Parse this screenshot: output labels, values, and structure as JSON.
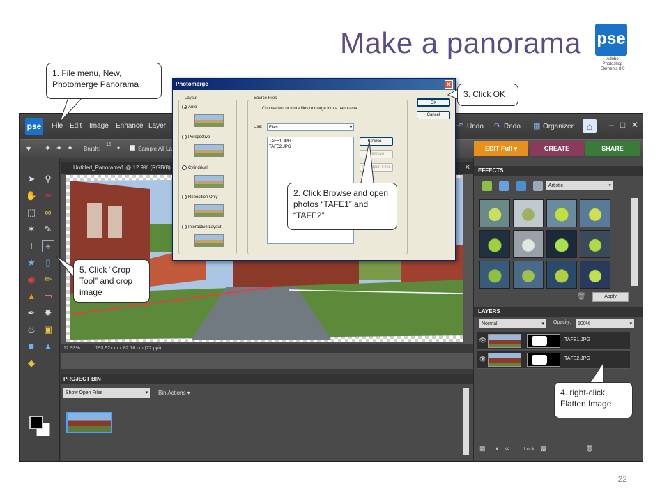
{
  "slide": {
    "title": "Make a panorama",
    "page_number": "22"
  },
  "logo": {
    "mark": "pse",
    "caption": [
      "Adobe",
      "Photoshop",
      "Elements 8.0"
    ]
  },
  "app": {
    "logo": "pse",
    "menu": [
      "File",
      "Edit",
      "Image",
      "Enhance",
      "Layer"
    ],
    "top_right": {
      "undo": "Undo",
      "redo": "Redo",
      "organizer": "Organizer"
    },
    "options": {
      "brush_label": "Brush:",
      "brush_size": "15",
      "sample_all": "Sample All Lay"
    },
    "mode_tabs": [
      "EDIT Full",
      "CREATE",
      "SHARE"
    ],
    "document": {
      "title": "Untitled_Panorama1 @ 12.9% (RGB/8) *",
      "zoom": "12.93%",
      "dimensions": "193.92 cm x 82.76 cm (72 ppi)"
    },
    "project_bin": {
      "header": "PROJECT BIN",
      "show": "Show Open Files",
      "actions": "Bin Actions"
    },
    "effects": {
      "header": "EFFECTS",
      "filter": "Artistic",
      "apply": "Apply"
    },
    "layers": {
      "header": "LAYERS",
      "blend": "Normal",
      "opacity_label": "Opacity:",
      "opacity_value": "100%",
      "items": [
        {
          "name": "TAFE1.JPG"
        },
        {
          "name": "TAFE2.JPG"
        }
      ],
      "lock_label": "Lock:"
    }
  },
  "dialog": {
    "title": "Photomerge",
    "layout_group": "Layout",
    "layouts": [
      "Auto",
      "Perspective",
      "Cylindrical",
      "Reposition Only",
      "Interactive Layout"
    ],
    "source_group": "Source Files",
    "instruction": "Choose two or more files to merge into a panorama",
    "use_label": "Use:",
    "use_value": "Files",
    "files": [
      "TAFE1.JPG",
      "TAFE2.JPG"
    ],
    "buttons": {
      "ok": "OK",
      "cancel": "Cancel",
      "browse": "Browse...",
      "remove": "Remove",
      "open_files": "Add Open Files"
    }
  },
  "callouts": {
    "step1": "1. File menu, New, Photomerge Panorama",
    "step2": "2. Click Browse and open photos “TAFE1” and “TAFE2”",
    "step3": "3. Click OK",
    "step4": "4. right-click, Flatten Image",
    "step5": "5. Click “Crop Tool” and crop image"
  },
  "colors": {
    "title": "#5b4a87",
    "accent_orange": "#e8901c",
    "app_bg": "#3c3c3c",
    "pse_blue": "#1a73c9"
  }
}
